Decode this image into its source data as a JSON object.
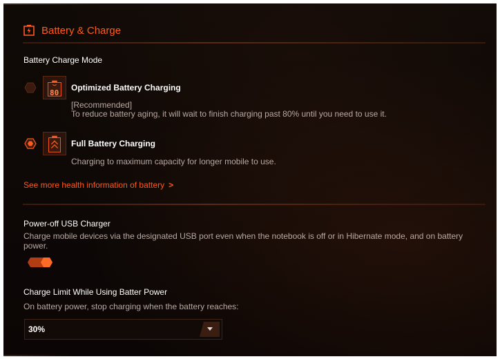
{
  "header": {
    "title": "Battery & Charge",
    "icon": "battery-charge-icon"
  },
  "charge_mode": {
    "label": "Battery Charge Mode",
    "options": [
      {
        "title": "Optimized Battery Charging",
        "badge": "80",
        "subtitle": "[Recommended]",
        "description": "To reduce battery aging, it will wait to finish charging past 80% until you need to use it.",
        "selected": false,
        "icon": "battery-80-icon"
      },
      {
        "title": "Full Battery Charging",
        "description": "Charging to maximum capacity for longer mobile to use.",
        "selected": true,
        "icon": "battery-full-icon"
      }
    ],
    "link": "See more health information of battery",
    "link_chevron": ">"
  },
  "usb_charger": {
    "label": "Power-off USB Charger",
    "description": "Charge mobile devices via the designated USB port even when the notebook is off or in Hibernate mode, and on battery power.",
    "enabled": true
  },
  "charge_limit": {
    "label": "Charge Limit While Using Batter Power",
    "description": "On battery power, stop charging when the battery reaches:",
    "selected": "30%"
  },
  "colors": {
    "accent": "#ff5a1f",
    "background": "#0d0806",
    "text": "#ffffff",
    "muted": "#b9a9a2"
  }
}
